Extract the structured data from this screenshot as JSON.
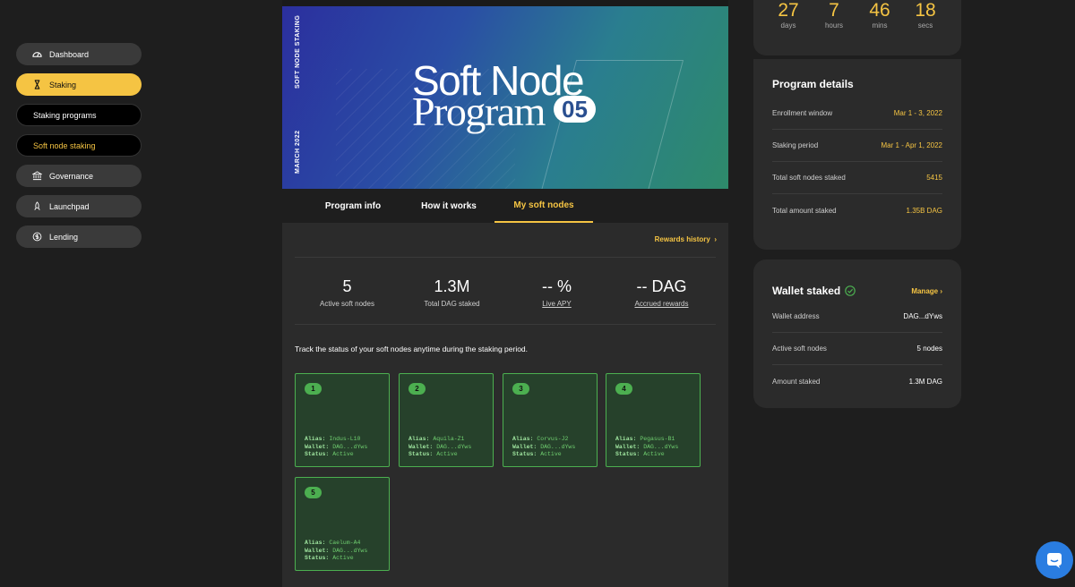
{
  "sidebar": {
    "items": [
      {
        "label": "Dashboard",
        "icon": "dashboard-icon"
      },
      {
        "label": "Staking",
        "icon": "hourglass-icon"
      },
      {
        "label": "Staking programs"
      },
      {
        "label": "Soft node staking"
      },
      {
        "label": "Governance",
        "icon": "bank-icon"
      },
      {
        "label": "Launchpad",
        "icon": "rocket-icon"
      },
      {
        "label": "Lending",
        "icon": "coin-icon"
      }
    ]
  },
  "banner": {
    "side_top": "SOFT NODE STAKING",
    "side_bottom": "MARCH 2022",
    "title_line1": "Soft Node",
    "title_line2": "Program",
    "badge": "05"
  },
  "tabs": [
    "Program info",
    "How it works",
    "My soft nodes"
  ],
  "rewards_link": "Rewards history",
  "stats": [
    {
      "value": "5",
      "label": "Active soft nodes"
    },
    {
      "value": "1.3M",
      "label": "Total DAG staked"
    },
    {
      "value": "-- %",
      "label": "Live APY"
    },
    {
      "value": "-- DAG",
      "label": "Accrued rewards"
    }
  ],
  "track_text": "Track the status of your soft nodes anytime during the staking period.",
  "node_labels": {
    "alias": "Alias:",
    "wallet": "Wallet:",
    "status": "Status:"
  },
  "nodes": [
    {
      "num": "1",
      "alias": "Indus-L10",
      "wallet": "DAG...dYws",
      "status": "Active"
    },
    {
      "num": "2",
      "alias": "Aquila-Z1",
      "wallet": "DAG...dYws",
      "status": "Active"
    },
    {
      "num": "3",
      "alias": "Corvus-J2",
      "wallet": "DAG...dYws",
      "status": "Active"
    },
    {
      "num": "4",
      "alias": "Pegasus-B1",
      "wallet": "DAG...dYws",
      "status": "Active"
    },
    {
      "num": "5",
      "alias": "Caelum-A4",
      "wallet": "DAG...dYws",
      "status": "Active"
    }
  ],
  "countdown": [
    {
      "n": "27",
      "u": "days"
    },
    {
      "n": "7",
      "u": "hours"
    },
    {
      "n": "46",
      "u": "mins"
    },
    {
      "n": "18",
      "u": "secs"
    }
  ],
  "program_details": {
    "title": "Program details",
    "rows": [
      {
        "k": "Enrollment window",
        "v": "Mar 1 - 3, 2022"
      },
      {
        "k": "Staking period",
        "v": "Mar 1 - Apr 1, 2022"
      },
      {
        "k": "Total soft nodes staked",
        "v": "5415"
      },
      {
        "k": "Total amount staked",
        "v": "1.35B DAG"
      }
    ]
  },
  "wallet": {
    "title": "Wallet staked",
    "manage": "Manage",
    "rows": [
      {
        "k": "Wallet address",
        "v": "DAG...dYws"
      },
      {
        "k": "Active soft nodes",
        "v": "5 nodes"
      },
      {
        "k": "Amount staked",
        "v": "1.3M DAG"
      }
    ]
  },
  "colors": {
    "accent": "#f5c443",
    "node_green": "#4caf50",
    "chat_blue": "#2a7de1"
  }
}
